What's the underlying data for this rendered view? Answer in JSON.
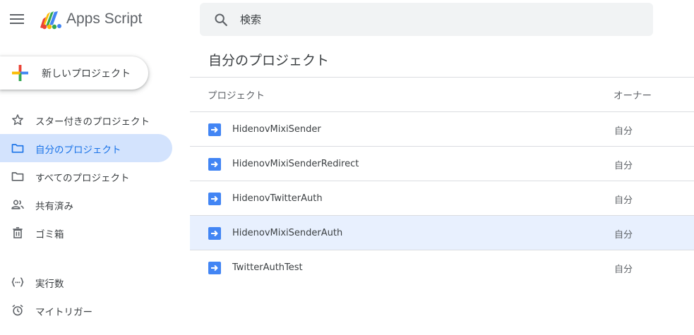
{
  "header": {
    "app_title": "Apps Script",
    "search": {
      "placeholder": "検索",
      "value": ""
    }
  },
  "sidebar": {
    "new_project_label": "新しいプロジェクト",
    "items": [
      {
        "label": "スター付きのプロジェクト",
        "icon": "star-icon"
      },
      {
        "label": "自分のプロジェクト",
        "icon": "folder-icon",
        "active": true
      },
      {
        "label": "すべてのプロジェクト",
        "icon": "folder-icon"
      },
      {
        "label": "共有済み",
        "icon": "people-icon"
      },
      {
        "label": "ゴミ箱",
        "icon": "trash-icon"
      },
      {
        "label": "実行数",
        "icon": "executions-icon"
      },
      {
        "label": "マイトリガー",
        "icon": "alarm-clock-icon"
      }
    ]
  },
  "main": {
    "title": "自分のプロジェクト",
    "columns": {
      "project": "プロジェクト",
      "owner": "オーナー"
    },
    "rows": [
      {
        "name": "HidenovMixiSender",
        "owner": "自分"
      },
      {
        "name": "HidenovMixiSenderRedirect",
        "owner": "自分"
      },
      {
        "name": "HidenovTwitterAuth",
        "owner": "自分"
      },
      {
        "name": "HidenovMixiSenderAuth",
        "owner": "自分"
      },
      {
        "name": "TwitterAuthTest",
        "owner": "自分"
      }
    ]
  },
  "colors": {
    "accent_blue": "#1a73e8",
    "active_nav_bg": "#d3e3fd",
    "hover_row_bg": "#e8f0fe",
    "project_icon_blue": "#4285f4"
  }
}
